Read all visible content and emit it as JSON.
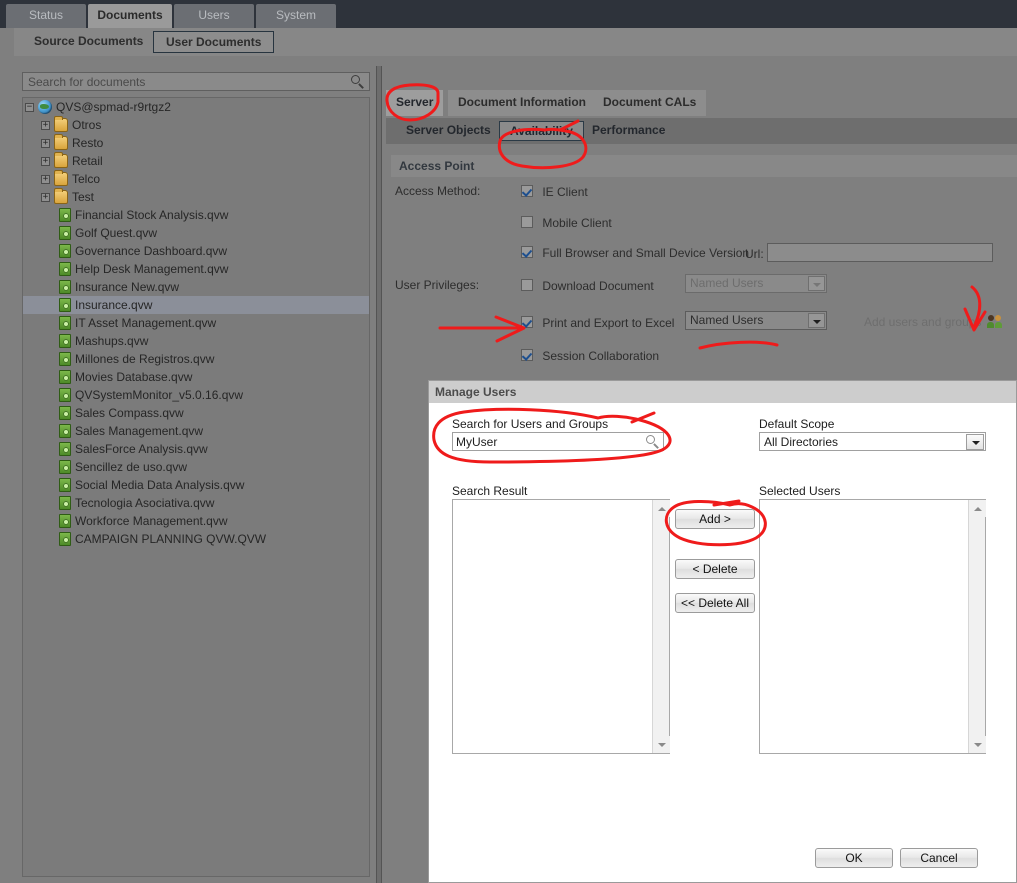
{
  "topnav": {
    "tabs": [
      {
        "label": "Status",
        "active": false
      },
      {
        "label": "Documents",
        "active": true
      },
      {
        "label": "Users",
        "active": false
      },
      {
        "label": "System",
        "active": false
      }
    ]
  },
  "subbar": {
    "tabs": [
      {
        "label": "Source Documents",
        "selected": false
      },
      {
        "label": "User Documents",
        "selected": true
      }
    ]
  },
  "left": {
    "search": {
      "value": "",
      "placeholder": "Search for documents",
      "icon": "search-icon"
    },
    "tree": [
      {
        "label": "QVS@spmad-r9rtgz2",
        "icon": "globe-icon",
        "level": 0,
        "expander": "−",
        "selected": false
      },
      {
        "label": "Otros",
        "icon": "folder-icon",
        "level": 1,
        "expander": "+",
        "selected": false
      },
      {
        "label": "Resto",
        "icon": "folder-icon",
        "level": 1,
        "expander": "+",
        "selected": false
      },
      {
        "label": "Retail",
        "icon": "folder-icon",
        "level": 1,
        "expander": "+",
        "selected": false
      },
      {
        "label": "Telco",
        "icon": "folder-icon",
        "level": 1,
        "expander": "+",
        "selected": false
      },
      {
        "label": "Test",
        "icon": "folder-icon",
        "level": 1,
        "expander": "+",
        "selected": false
      },
      {
        "label": "Financial Stock Analysis.qvw",
        "icon": "qvw-document-icon",
        "level": 2,
        "expander": "",
        "selected": false
      },
      {
        "label": "Golf Quest.qvw",
        "icon": "qvw-document-icon",
        "level": 2,
        "expander": "",
        "selected": false
      },
      {
        "label": "Governance Dashboard.qvw",
        "icon": "qvw-document-icon",
        "level": 2,
        "expander": "",
        "selected": false
      },
      {
        "label": "Help Desk Management.qvw",
        "icon": "qvw-document-icon",
        "level": 2,
        "expander": "",
        "selected": false
      },
      {
        "label": "Insurance New.qvw",
        "icon": "qvw-document-icon",
        "level": 2,
        "expander": "",
        "selected": false
      },
      {
        "label": "Insurance.qvw",
        "icon": "qvw-document-icon",
        "level": 2,
        "expander": "",
        "selected": true
      },
      {
        "label": "IT Asset Management.qvw",
        "icon": "qvw-document-icon",
        "level": 2,
        "expander": "",
        "selected": false
      },
      {
        "label": "Mashups.qvw",
        "icon": "qvw-document-icon",
        "level": 2,
        "expander": "",
        "selected": false
      },
      {
        "label": "Millones de Registros.qvw",
        "icon": "qvw-document-icon",
        "level": 2,
        "expander": "",
        "selected": false
      },
      {
        "label": "Movies Database.qvw",
        "icon": "qvw-document-icon",
        "level": 2,
        "expander": "",
        "selected": false
      },
      {
        "label": "QVSystemMonitor_v5.0.16.qvw",
        "icon": "qvw-document-icon",
        "level": 2,
        "expander": "",
        "selected": false
      },
      {
        "label": "Sales Compass.qvw",
        "icon": "qvw-document-icon",
        "level": 2,
        "expander": "",
        "selected": false
      },
      {
        "label": "Sales Management.qvw",
        "icon": "qvw-document-icon",
        "level": 2,
        "expander": "",
        "selected": false
      },
      {
        "label": "SalesForce Analysis.qvw",
        "icon": "qvw-document-icon",
        "level": 2,
        "expander": "",
        "selected": false
      },
      {
        "label": "Sencillez de uso.qvw",
        "icon": "qvw-document-icon",
        "level": 2,
        "expander": "",
        "selected": false
      },
      {
        "label": "Social Media Data Analysis.qvw",
        "icon": "qvw-document-icon",
        "level": 2,
        "expander": "",
        "selected": false
      },
      {
        "label": "Tecnologia Asociativa.qvw",
        "icon": "qvw-document-icon",
        "level": 2,
        "expander": "",
        "selected": false
      },
      {
        "label": "Workforce Management.qvw",
        "icon": "qvw-document-icon",
        "level": 2,
        "expander": "",
        "selected": false
      },
      {
        "label": "CAMPAIGN PLANNING QVW.QVW",
        "icon": "qvw-document-icon",
        "level": 2,
        "expander": "",
        "selected": false
      }
    ]
  },
  "right": {
    "tabs": [
      {
        "label": "Server",
        "active": true
      },
      {
        "label": "Document Information",
        "active": false
      },
      {
        "label": "Document CALs",
        "active": false
      }
    ],
    "inner_tabs": [
      {
        "label": "Server Objects",
        "selected": false
      },
      {
        "label": "Availability",
        "selected": true
      },
      {
        "label": "Performance",
        "selected": false
      }
    ],
    "section_title": "Access Point",
    "access_method_label": "Access Method:",
    "user_privileges_label": "User Privileges:",
    "url_label": "Url:",
    "url_value": "",
    "access_methods": [
      {
        "label": "IE Client",
        "checked": true
      },
      {
        "label": "Mobile Client",
        "checked": false
      },
      {
        "label": "Full Browser and Small Device Version",
        "checked": true
      }
    ],
    "privileges": [
      {
        "label": "Download Document",
        "checked": false,
        "cal": "Named Users",
        "disabled": true
      },
      {
        "label": "Print and Export to Excel",
        "checked": true,
        "cal": "Named Users",
        "disabled": false
      },
      {
        "label": "Session Collaboration",
        "checked": true,
        "cal": "",
        "disabled": false
      }
    ],
    "add_users_label": "Add users and groups",
    "add_users_icon": "users-group-icon"
  },
  "dialog": {
    "title": "Manage Users",
    "search_label": "Search for Users and Groups",
    "search_value": "MyUser",
    "search_icon": "search-icon",
    "scope_label": "Default Scope",
    "scope_value": "All Directories",
    "search_result_label": "Search Result",
    "selected_users_label": "Selected Users",
    "search_result_items": [],
    "selected_users_items": [],
    "buttons": {
      "add": "Add >",
      "delete": "< Delete",
      "delete_all": "<< Delete All",
      "ok": "OK",
      "cancel": "Cancel"
    }
  },
  "annotations": {
    "color": "#ef1b1b",
    "marks": [
      "circle-server-tab",
      "circle-availability-tab",
      "arrow-print-export-checkbox",
      "underline-named-users-dropdown",
      "arrow-add-users-and-groups",
      "circle-search-for-users-and-groups",
      "circle-add-button"
    ]
  }
}
